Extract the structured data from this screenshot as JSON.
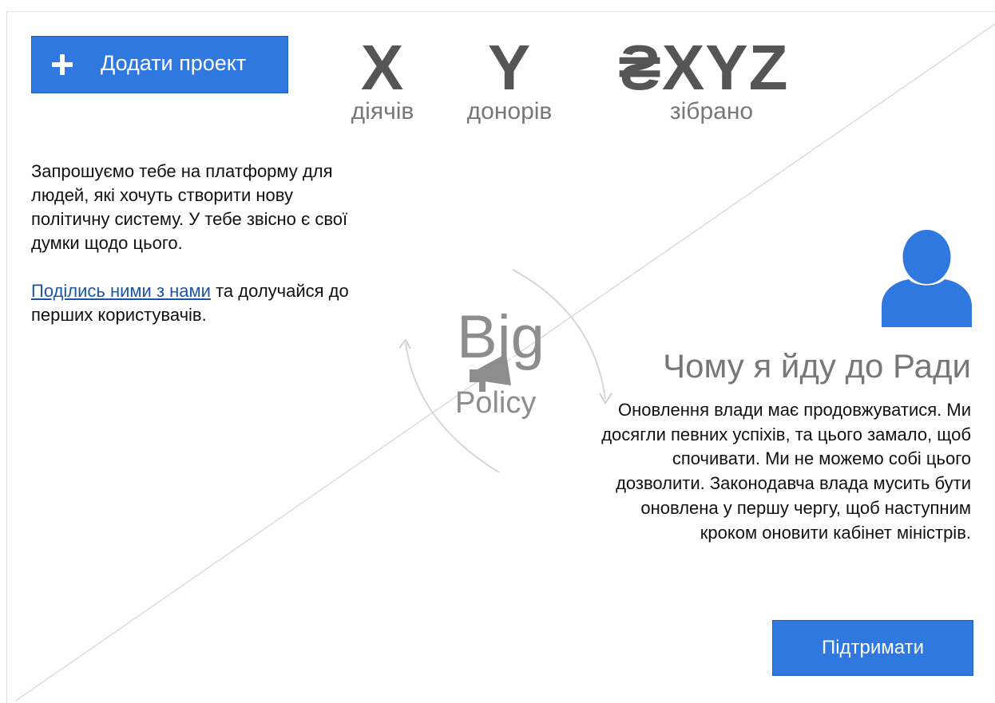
{
  "header": {
    "add_project_label": "Додати проект",
    "add_project_icon": "plus-icon"
  },
  "stats": [
    {
      "value": "X",
      "label": "діячів"
    },
    {
      "value": "Y",
      "label": "донорів"
    },
    {
      "value": "₴XYZ",
      "label": "зібрано"
    }
  ],
  "intro": {
    "paragraph": "Запрошуємо тебе  на платформу для людей, які хочуть створити нову політичну систему. У тебе звісно є свої думки щодо цього.",
    "link_text": "Поділись ними з нами",
    "after_link": " та долучайся до перших користувачів."
  },
  "logo": {
    "word_top": "Big",
    "word_bottom": "Policy",
    "icon": "megaphone-icon"
  },
  "candidate": {
    "avatar_icon": "user-icon",
    "title": "Чому я йду до Ради",
    "text": "Оновлення влади має продовжуватися. Ми досягли певних успіхів, та цього замало, щоб спочивати. Ми не можемо собі цього дозволити. Законодавча влада мусить бути оновлена у першу чергу, щоб наступним кроком оновити кабінет міністрів.",
    "support_label": "Підтримати"
  },
  "colors": {
    "accent": "#2f78e0",
    "stat_text": "#555555",
    "link": "#1a56a8",
    "logo_gray": "#8d8d8d"
  }
}
